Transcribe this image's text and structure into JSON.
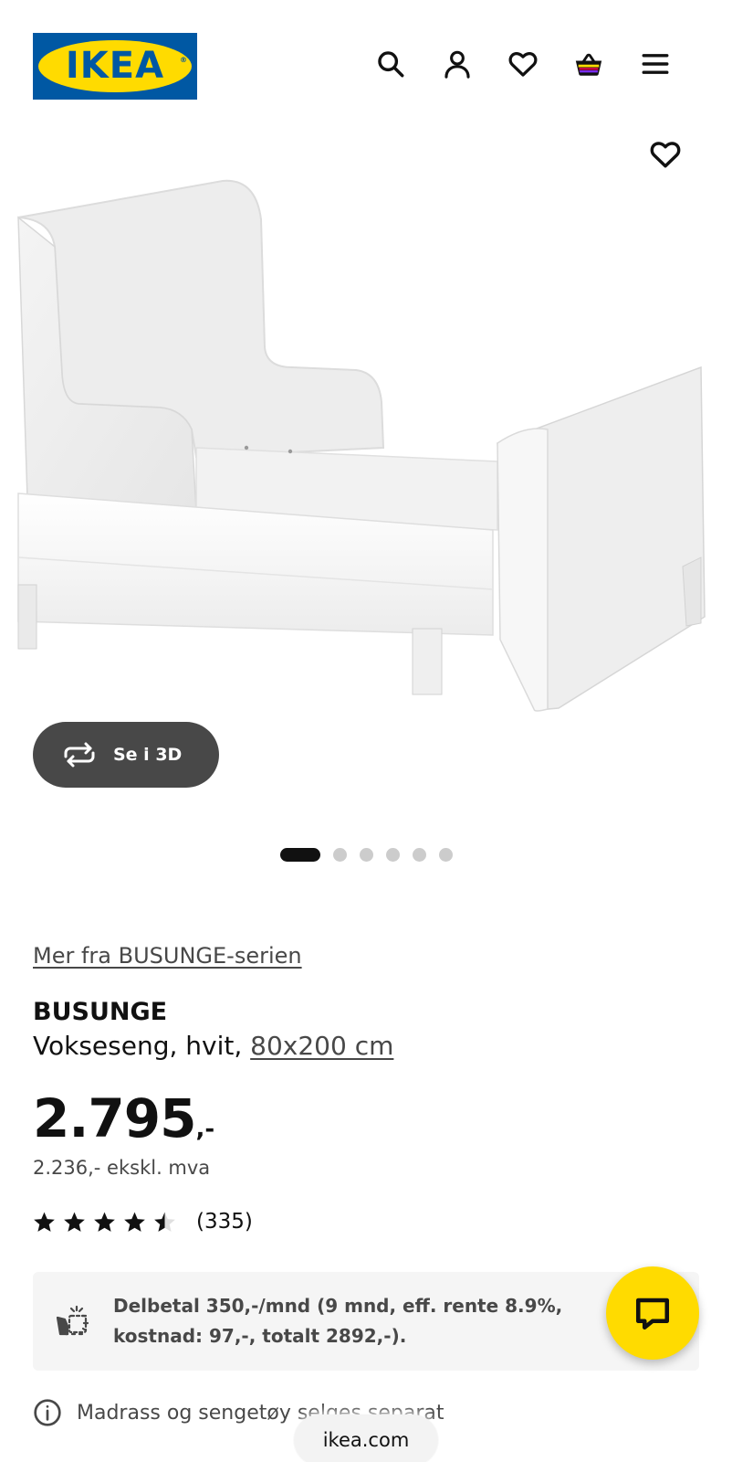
{
  "header": {
    "logo_text": "IKEA",
    "logo_reg": "®",
    "icons": [
      "search-icon",
      "account-icon",
      "wishlist-heart-icon",
      "shopping-bag-icon",
      "menu-icon"
    ]
  },
  "product_image": {
    "favorite_icon": "heart-outline-icon",
    "view_3d_label": "Se i 3D",
    "carousel_total": 6,
    "carousel_active": 1
  },
  "product": {
    "series_link": "Mer fra BUSUNGE-serien",
    "name": "BUSUNGE",
    "description": "Vokseseng, hvit,",
    "size_link": "80x200 cm",
    "price_integer": "2.795",
    "price_suffix": ",-",
    "price_ex_vat": "2.236,- ekskl. mva",
    "rating_stars": 4.5,
    "rating_max": 5,
    "review_count": "(335)"
  },
  "installment": {
    "text": "Delbetal 350,-/mnd (9 mnd, eff. rente 8.9%, kostnad: 97,-, totalt 2892,-)."
  },
  "notice": {
    "text": "Madrass og sengetøy selges separat"
  },
  "browser": {
    "url": "ikea.com"
  },
  "colors": {
    "ikea_blue": "#0058a3",
    "ikea_yellow": "#ffdb00",
    "dark_button": "#484848"
  }
}
